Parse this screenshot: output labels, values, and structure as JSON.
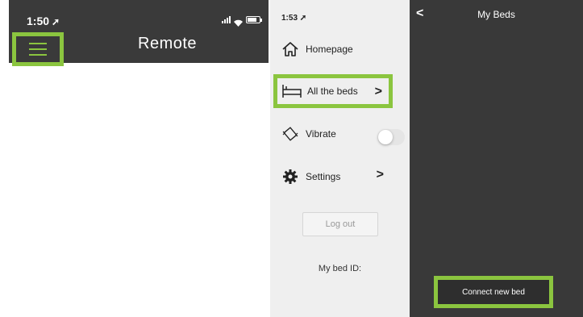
{
  "remote": {
    "time": "1:50",
    "title": "Remote",
    "battery_level": 0.8,
    "accent_color": "#8bc53f",
    "header_color": "#3a3a3a",
    "menu_icon": "hamburger-menu-icon"
  },
  "side_menu": {
    "time": "1:53",
    "items": [
      {
        "label": "Homepage",
        "icon": "home-icon"
      },
      {
        "label": "All the beds",
        "icon": "bed-icon",
        "chevron": ">"
      },
      {
        "label": "Vibrate",
        "icon": "vibrate-icon",
        "toggle_on": false
      },
      {
        "label": "Settings",
        "icon": "gear-icon",
        "chevron": ">"
      }
    ],
    "logout_label": "Log out",
    "bed_id_label": "My bed ID:"
  },
  "my_beds": {
    "back": "<",
    "title": "My Beds",
    "connect_label": "Connect new bed",
    "background_color": "#393939"
  }
}
